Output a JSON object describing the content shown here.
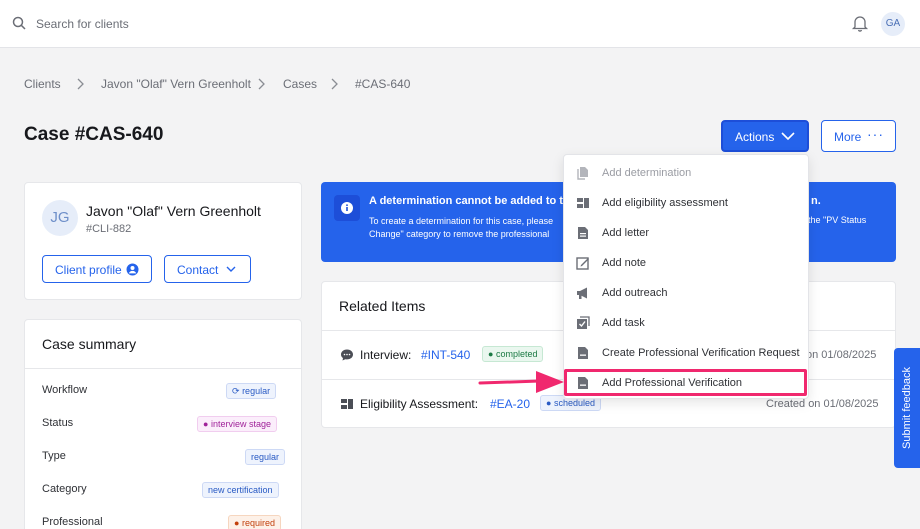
{
  "search": {
    "placeholder": "Search for clients"
  },
  "user": {
    "initials": "GA"
  },
  "breadcrumb": [
    "Clients",
    "Javon \"Olaf\" Vern Greenholt",
    "Cases",
    "#CAS-640"
  ],
  "page": {
    "title": "Case #CAS-640"
  },
  "toolbar": {
    "actions_label": "Actions",
    "more_label": "More"
  },
  "client": {
    "initials": "JG",
    "name": "Javon \"Olaf\" Vern Greenholt",
    "id": "#CLI-882",
    "profile_button": "Client profile",
    "contact_button": "Contact"
  },
  "summary": {
    "title": "Case summary",
    "rows": [
      {
        "label": "Workflow",
        "value": "regular"
      },
      {
        "label": "Status",
        "value": "interview stage"
      },
      {
        "label": "Type",
        "value": "regular"
      },
      {
        "label": "Category",
        "value": "new certification"
      },
      {
        "label": "Professional",
        "value": "required"
      }
    ]
  },
  "alert": {
    "title": "A determination cannot be added to thi",
    "title_tail": "n.",
    "body_line1": "To create a determination for this case, please",
    "body_line2": "Change\" category to remove the professional",
    "body_tail": "the \"PV Status"
  },
  "related": {
    "title": "Related Items",
    "items": [
      {
        "label": "Interview:",
        "link": "#INT-540",
        "badge": "completed",
        "date": "on 01/08/2025"
      },
      {
        "label": "Eligibility Assessment:",
        "link": "#EA-20",
        "badge": "scheduled",
        "date": "Created on 01/08/2025"
      }
    ]
  },
  "menu": {
    "items": [
      {
        "label": "Add determination",
        "icon": "document-copy-icon",
        "disabled": true
      },
      {
        "label": "Add eligibility assessment",
        "icon": "assessment-icon",
        "disabled": false
      },
      {
        "label": "Add letter",
        "icon": "letter-icon",
        "disabled": false
      },
      {
        "label": "Add note",
        "icon": "note-icon",
        "disabled": false
      },
      {
        "label": "Add outreach",
        "icon": "megaphone-icon",
        "disabled": false
      },
      {
        "label": "Add task",
        "icon": "task-icon",
        "disabled": false
      },
      {
        "label": "Create Professional Verification Request",
        "icon": "document-icon",
        "disabled": false
      },
      {
        "label": "Add Professional Verification",
        "icon": "document-icon",
        "disabled": false
      }
    ]
  },
  "feedback": {
    "label": "Submit feedback"
  },
  "colors": {
    "primary": "#2563eb",
    "highlight": "#f0286e"
  }
}
